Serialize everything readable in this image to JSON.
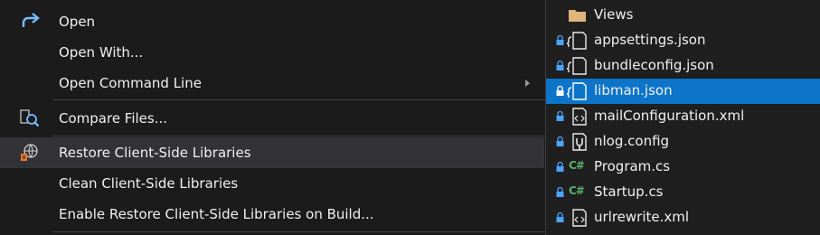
{
  "context_menu": {
    "items": [
      {
        "label": "Open",
        "icon": "redo-arrow-icon"
      },
      {
        "label": "Open With...",
        "icon": ""
      },
      {
        "label": "Open Command Line",
        "icon": "",
        "has_submenu": true
      },
      {
        "label": "Compare Files...",
        "icon": "compare-files-icon"
      },
      {
        "label": "Restore Client-Side Libraries",
        "icon": "restore-libraries-icon",
        "hovered": true
      },
      {
        "label": "Clean Client-Side Libraries",
        "icon": ""
      },
      {
        "label": "Enable Restore Client-Side Libraries on Build...",
        "icon": ""
      }
    ]
  },
  "solution_explorer": {
    "items": [
      {
        "label": "Views",
        "icon": "folder-icon"
      },
      {
        "label": "appsettings.json",
        "icon": "json-file-icon"
      },
      {
        "label": "bundleconfig.json",
        "icon": "json-file-icon"
      },
      {
        "label": "libman.json",
        "icon": "json-file-icon",
        "selected": true
      },
      {
        "label": "mailConfiguration.xml",
        "icon": "xml-file-icon"
      },
      {
        "label": "nlog.config",
        "icon": "config-file-icon"
      },
      {
        "label": "Program.cs",
        "icon": "csharp-file-icon",
        "badge": "C#"
      },
      {
        "label": "Startup.cs",
        "icon": "csharp-file-icon",
        "badge": "C#"
      },
      {
        "label": "urlrewrite.xml",
        "icon": "xml-file-icon"
      }
    ]
  },
  "colors": {
    "menu_background": "#1b1b1c",
    "hover_background": "#333337",
    "selection_blue": "#0c74c9",
    "csharp_green": "#57b26a",
    "folder_yellow": "#dcb67a",
    "arrow_blue": "#75beff"
  }
}
